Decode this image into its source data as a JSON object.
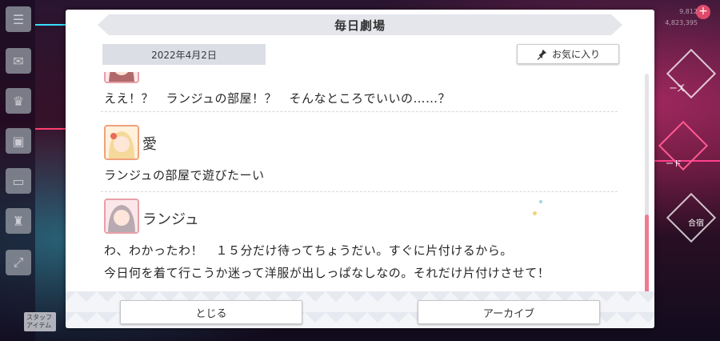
{
  "dialog": {
    "title": "毎日劇場",
    "date": "2022年4月2日",
    "favorite_label": "お気に入り",
    "close_label": "とじる",
    "archive_label": "アーカイブ"
  },
  "messages": [
    {
      "speaker": "",
      "lines": [
        "ええ！？　ランジュの部屋！？　そんなところでいいの……？"
      ]
    },
    {
      "speaker": "愛",
      "lines": [
        "ランジュの部屋で遊びたーい"
      ]
    },
    {
      "speaker": "ランジュ",
      "lines": [
        "わ、わかったわ！　１５分だけ待ってちょうだい。すぐに片付けるから。",
        "今日何を着て行こうか迷って洋服が出しっぱなしなの。それだけ片付けさせて！"
      ]
    }
  ],
  "background": {
    "rail_icons": [
      "menu-icon",
      "chat-icon",
      "present-icon",
      "gift-icon",
      "screen-icon",
      "cup-icon",
      "expand-icon"
    ],
    "counter_top": "9,812",
    "counter_bottom": "4,823,395",
    "rail_label": "スタッフ アイテム",
    "right_labels": [
      "ーズ",
      "ード",
      "合宿"
    ]
  },
  "colors": {
    "accent_pink": "#f07a90",
    "avatar_border": "#f0a27a",
    "title_bar": "#e4e6ec"
  }
}
